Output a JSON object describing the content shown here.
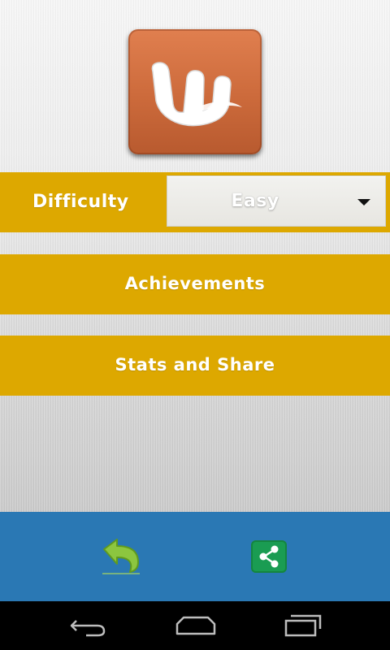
{
  "app_icon": "word-w-logo-icon",
  "difficulty": {
    "label": "Difficulty",
    "selected": "Easy"
  },
  "menu": {
    "achievements_label": "Achievements",
    "stats_label": "Stats and Share"
  },
  "bottom_bar": {
    "back_icon": "back-arrow-icon",
    "share_icon": "share-icon"
  },
  "colors": {
    "band": "#dda800",
    "bottom_bar": "#2a78b4",
    "share": "#1a9c52",
    "logo": "#cc6a3b"
  },
  "navigation": {
    "back_icon": "nav-back-icon",
    "home_icon": "nav-home-icon",
    "recent_icon": "nav-recent-apps-icon"
  }
}
